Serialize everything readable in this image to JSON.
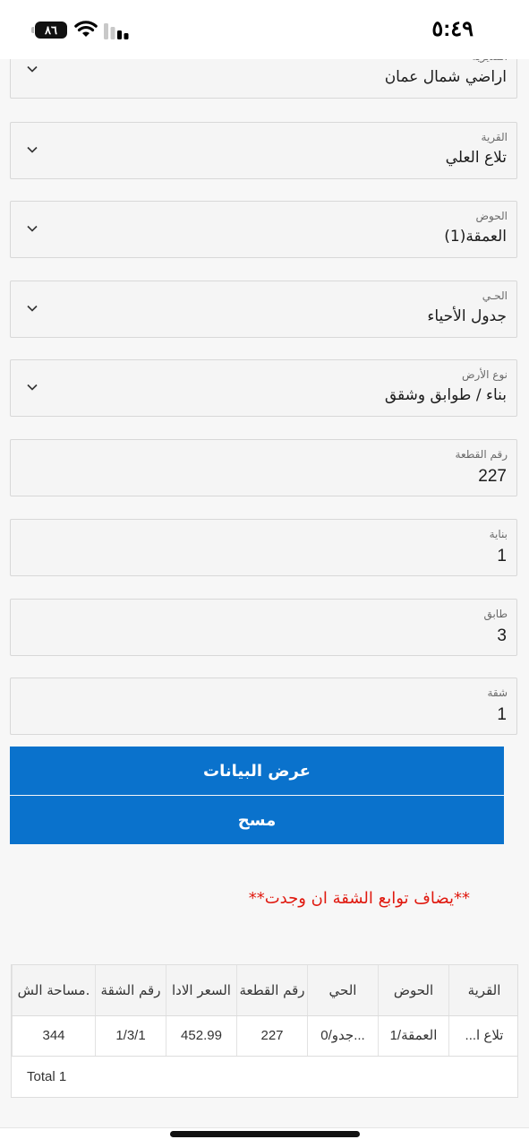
{
  "status_bar": {
    "time": "٥:٤٩",
    "battery": "٨٦"
  },
  "form": {
    "fields": [
      {
        "label": "المديرية",
        "value": "اراضي شمال عمان",
        "type": "select"
      },
      {
        "label": "القرية",
        "value": "تلاع العلي",
        "type": "select"
      },
      {
        "label": "الحوض",
        "value": "العمقة(1)",
        "type": "select"
      },
      {
        "label": "الحـي",
        "value": "جدول الأحياء",
        "type": "select"
      },
      {
        "label": "نوع الأرض",
        "value": "بناء / طوابق وشقق",
        "type": "select"
      },
      {
        "label": "رقم القطعة",
        "value": "227",
        "type": "input"
      },
      {
        "label": "بناية",
        "value": "1",
        "type": "input"
      },
      {
        "label": "طابق",
        "value": "3",
        "type": "input"
      },
      {
        "label": "شقة",
        "value": "1",
        "type": "input"
      }
    ],
    "show_button": "عرض البيانات",
    "clear_button": "مسح"
  },
  "note": "**يضاف توابع الشقة ان وجدت**",
  "table": {
    "headers": [
      "القرية",
      "الحوض",
      "الحي",
      "رقم القطعة",
      "السعر الادا",
      "رقم الشقة",
      ".مساحة الش"
    ],
    "rows": [
      [
        "تلاع ا...",
        "1/العمقة",
        "0/جدو...",
        "227",
        "452.99",
        "1/3/1",
        "344"
      ]
    ],
    "total": "Total 1"
  },
  "colors": {
    "accent": "#0a72cc",
    "note": "#e0190f"
  }
}
